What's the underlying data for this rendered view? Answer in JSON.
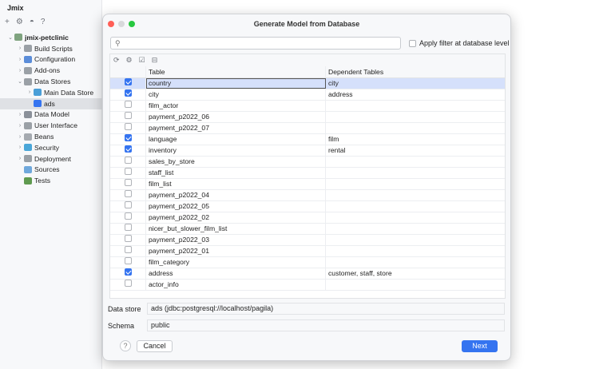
{
  "app": {
    "title": "Jmix"
  },
  "sidebar": {
    "items": [
      {
        "label": "jmix-petclinic",
        "level": 0,
        "chev": "⌄",
        "color": "#7fa37f",
        "bold": true
      },
      {
        "label": "Build Scripts",
        "level": 1,
        "chev": "›",
        "color": "#9aa0a6"
      },
      {
        "label": "Configuration",
        "level": 1,
        "chev": "›",
        "color": "#5b8dd9"
      },
      {
        "label": "Add-ons",
        "level": 1,
        "chev": "›",
        "color": "#9aa0a6"
      },
      {
        "label": "Data Stores",
        "level": 1,
        "chev": "⌄",
        "color": "#9aa0a6"
      },
      {
        "label": "Main Data Store",
        "level": 2,
        "chev": "›",
        "color": "#4a9fd8"
      },
      {
        "label": "ads",
        "level": 2,
        "chev": "",
        "color": "#3574f0",
        "selected": true
      },
      {
        "label": "Data Model",
        "level": 1,
        "chev": "›",
        "color": "#8a9099"
      },
      {
        "label": "User Interface",
        "level": 1,
        "chev": "›",
        "color": "#9aa0a6"
      },
      {
        "label": "Beans",
        "level": 1,
        "chev": "›",
        "color": "#a5aab0"
      },
      {
        "label": "Security",
        "level": 1,
        "chev": "›",
        "color": "#4aa6d8"
      },
      {
        "label": "Deployment",
        "level": 1,
        "chev": "›",
        "color": "#9aa0a6"
      },
      {
        "label": "Sources",
        "level": 1,
        "chev": "",
        "color": "#6fa8dc"
      },
      {
        "label": "Tests",
        "level": 1,
        "chev": "",
        "color": "#5f9a4f"
      }
    ]
  },
  "dialog": {
    "title": "Generate Model from Database",
    "search_placeholder": "",
    "apply_filter_label": "Apply filter at database level",
    "apply_filter_checked": false,
    "columns": {
      "table": "Table",
      "dependent": "Dependent Tables"
    },
    "rows": [
      {
        "checked": true,
        "table": "country",
        "dependent": "city",
        "selected": true
      },
      {
        "checked": true,
        "table": "city",
        "dependent": "address"
      },
      {
        "checked": false,
        "table": "film_actor",
        "dependent": ""
      },
      {
        "checked": false,
        "table": "payment_p2022_06",
        "dependent": ""
      },
      {
        "checked": false,
        "table": "payment_p2022_07",
        "dependent": ""
      },
      {
        "checked": true,
        "table": "language",
        "dependent": "film"
      },
      {
        "checked": true,
        "table": "inventory",
        "dependent": "rental"
      },
      {
        "checked": false,
        "table": "sales_by_store",
        "dependent": ""
      },
      {
        "checked": false,
        "table": "staff_list",
        "dependent": ""
      },
      {
        "checked": false,
        "table": "film_list",
        "dependent": ""
      },
      {
        "checked": false,
        "table": "payment_p2022_04",
        "dependent": ""
      },
      {
        "checked": false,
        "table": "payment_p2022_05",
        "dependent": ""
      },
      {
        "checked": false,
        "table": "payment_p2022_02",
        "dependent": ""
      },
      {
        "checked": false,
        "table": "nicer_but_slower_film_list",
        "dependent": ""
      },
      {
        "checked": false,
        "table": "payment_p2022_03",
        "dependent": ""
      },
      {
        "checked": false,
        "table": "payment_p2022_01",
        "dependent": ""
      },
      {
        "checked": false,
        "table": "film_category",
        "dependent": ""
      },
      {
        "checked": true,
        "table": "address",
        "dependent": "customer, staff, store"
      },
      {
        "checked": false,
        "table": "actor_info",
        "dependent": ""
      }
    ],
    "data_store_label": "Data store",
    "data_store_value": "ads (jdbc:postgresql://localhost/pagila)",
    "schema_label": "Schema",
    "schema_value": "public",
    "help": "?",
    "cancel": "Cancel",
    "next": "Next",
    "accent": "#3574f0"
  }
}
